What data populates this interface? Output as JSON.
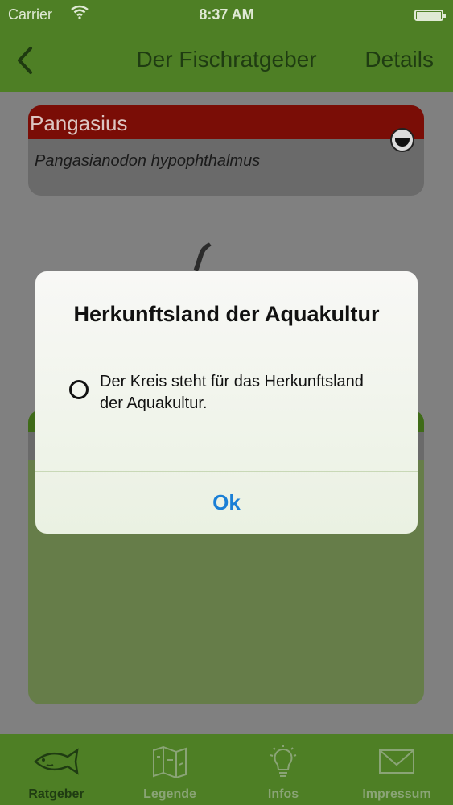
{
  "status_bar": {
    "carrier": "Carrier",
    "wifi_icon": "wifi-icon",
    "time": "8:37 AM",
    "battery_icon": "battery-icon"
  },
  "nav": {
    "back_icon": "chevron-left-icon",
    "title": "Der Fischratgeber",
    "details_label": "Details"
  },
  "card": {
    "name": "Pangasius",
    "latin": "Pangasianodon hypophthalmus",
    "dish_icon": "dish-icon"
  },
  "alert": {
    "title": "Herkunftsland der Aquakultur",
    "legend_icon": "circle-icon",
    "message": "Der Kreis steht für das Herkunftsland der Aquakultur.",
    "ok_label": "Ok"
  },
  "tabs": [
    {
      "label": "Ratgeber",
      "icon": "fish-icon",
      "active": true
    },
    {
      "label": "Legende",
      "icon": "map-icon",
      "active": false
    },
    {
      "label": "Infos",
      "icon": "lightbulb-icon",
      "active": false
    },
    {
      "label": "Impressum",
      "icon": "envelope-icon",
      "active": false
    }
  ],
  "colors": {
    "bar_green": "#4e7f25",
    "card_header_red": "#7a0d06",
    "alert_button_blue": "#1a7fd6"
  }
}
